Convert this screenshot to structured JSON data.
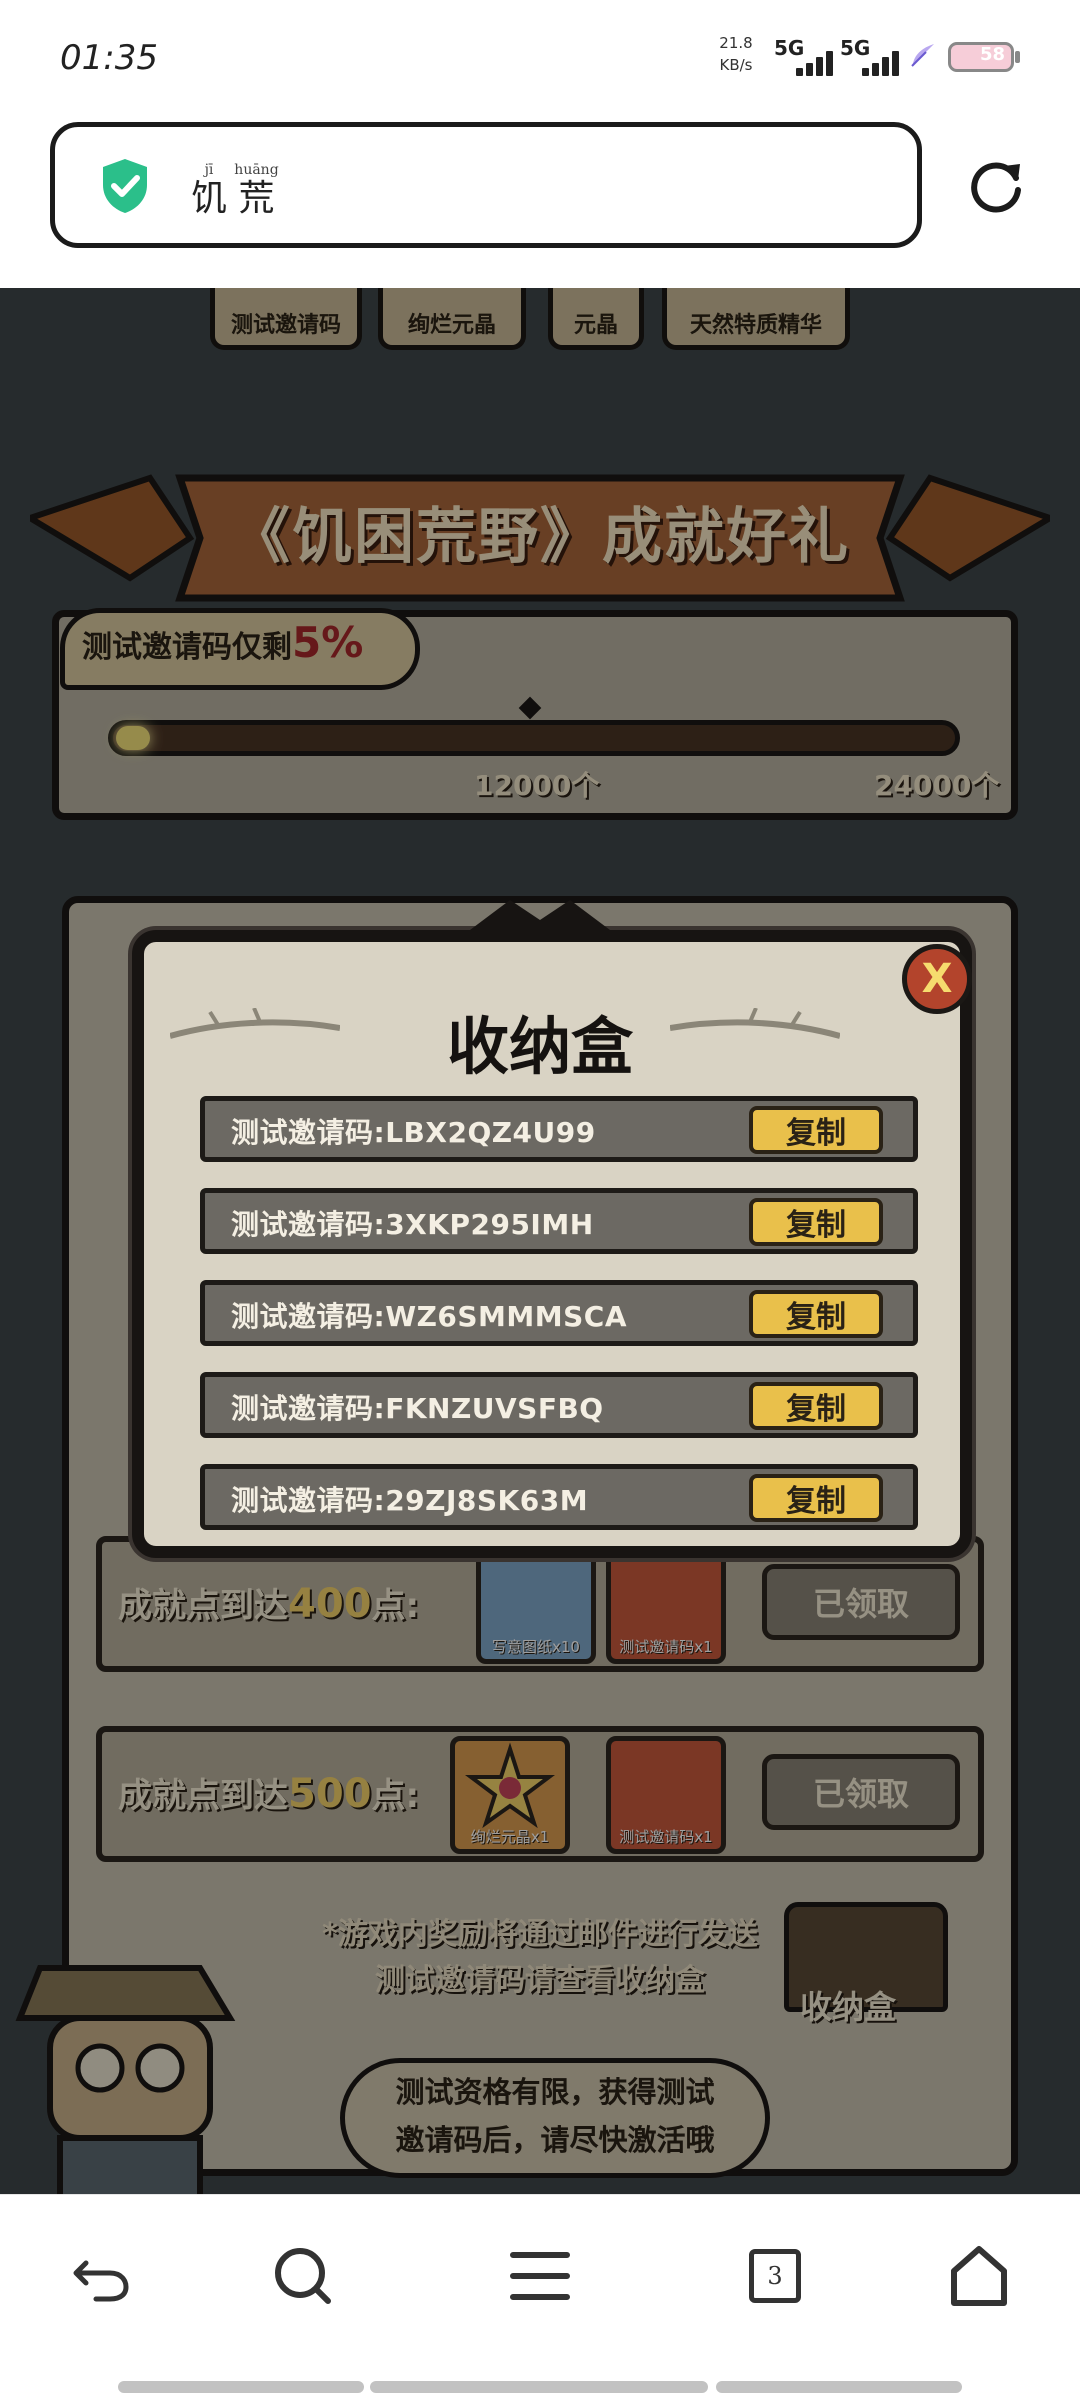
{
  "status": {
    "time": "01:35",
    "net_speed_value": "21.8",
    "net_speed_unit": "KB/s",
    "sim1": "5G",
    "sim2": "5G",
    "battery": "58"
  },
  "address_bar": {
    "title_char1": "饥",
    "title_char1_pinyin": "jī",
    "title_char2": "荒",
    "title_char2_pinyin": "huāng"
  },
  "game": {
    "tabs": [
      "测试邀请码",
      "绚烂元晶",
      "元晶",
      "天然特质精华"
    ],
    "banner_title": "《饥困荒野》成就好礼",
    "progress": {
      "callout_prefix": "测试邀请码仅剩",
      "callout_percent": "5%",
      "fill_fraction": 0.05,
      "tick_mid": "12000个",
      "tick_end": "24000个"
    },
    "tiers": [
      {
        "label_prefix": "成就点到达",
        "points": "400",
        "label_suffix": "点:",
        "rewards": [
          "写意图纸x10",
          "测试邀请码x1"
        ],
        "button": "已领取"
      },
      {
        "label_prefix": "成就点到达",
        "points": "500",
        "label_suffix": "点:",
        "rewards": [
          "绚烂元晶x1",
          "测试邀请码x1"
        ],
        "button": "已领取"
      }
    ],
    "notice_line1": "*游戏内奖励将通过邮件进行发送",
    "notice_line2": "测试邀请码请查看收纳盒",
    "chest_label": "收纳盒",
    "bubble_line1": "测试资格有限，获得测试",
    "bubble_line2": "邀请码后，请尽快激活哦"
  },
  "modal": {
    "title": "收纳盒",
    "close_label": "X",
    "codes": [
      "测试邀请码:LBX2QZ4U99",
      "测试邀请码:3XKP295IMH",
      "测试邀请码:WZ6SMMMSCA",
      "测试邀请码:FKNZUVSFBQ",
      "测试邀请码:29ZJ8SK63M"
    ],
    "copy_label": "复制"
  },
  "nav": {
    "tab_count": "3"
  },
  "colors": {
    "accent_gold": "#e9c04b",
    "warning_red": "#a5282a",
    "secure_green": "#2bbf8a"
  }
}
